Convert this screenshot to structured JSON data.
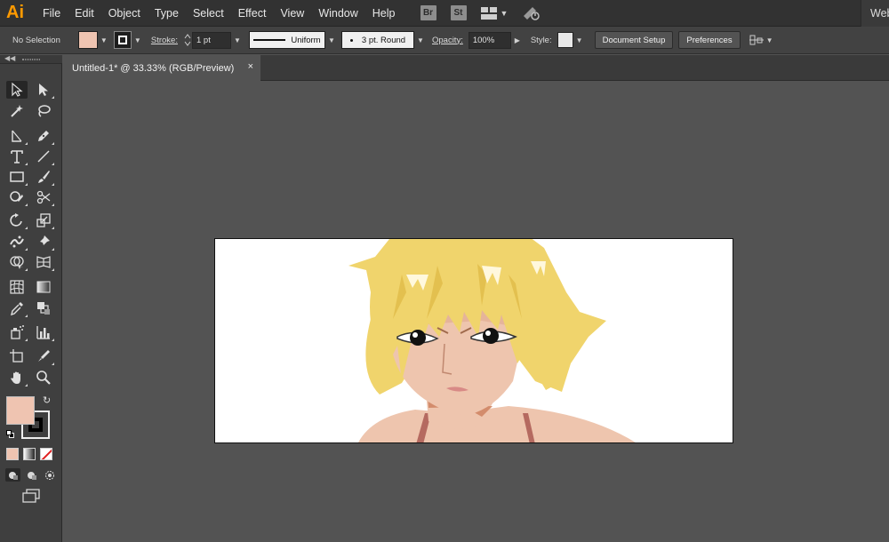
{
  "app": {
    "logo": "Ai",
    "brand_color": "#ff9a00"
  },
  "menubar": {
    "items": [
      "File",
      "Edit",
      "Object",
      "Type",
      "Select",
      "Effect",
      "View",
      "Window",
      "Help"
    ],
    "bridge_label": "Br",
    "stock_label": "St",
    "workspace_label": "Web"
  },
  "controlbar": {
    "selection_status": "No Selection",
    "fill_color": "#efc4b1",
    "stroke_label": "Stroke:",
    "stroke_weight": "1 pt",
    "stroke_profile": "Uniform",
    "brush": "3 pt. Round",
    "opacity_label": "Opacity:",
    "opacity_value": "100%",
    "style_label": "Style:",
    "document_setup_label": "Document Setup",
    "preferences_label": "Preferences"
  },
  "document": {
    "tab_title": "Untitled-1* @ 33.33% (RGB/Preview)",
    "close_glyph": "×"
  },
  "tools": {
    "fill_swatch": "#efc4b1",
    "stroke_swatch": "#000000",
    "icons": [
      "selection-tool-icon",
      "direct-selection-tool-icon",
      "magic-wand-icon",
      "lasso-icon",
      "pen-tool-icon",
      "curvature-tool-icon",
      "type-tool-icon",
      "line-segment-icon",
      "rectangle-tool-icon",
      "paintbrush-icon",
      "shaper-tool-icon",
      "scissors-icon",
      "rotate-tool-icon",
      "scale-tool-icon",
      "puppet-warp-icon",
      "pin-icon",
      "shape-builder-icon",
      "perspective-grid-icon",
      "mesh-tool-icon",
      "gradient-tool-icon",
      "eyedropper-icon",
      "blend-tool-icon",
      "symbol-sprayer-icon",
      "column-graph-icon",
      "artboard-tool-icon",
      "slice-tool-icon",
      "hand-tool-icon",
      "zoom-tool-icon"
    ]
  }
}
